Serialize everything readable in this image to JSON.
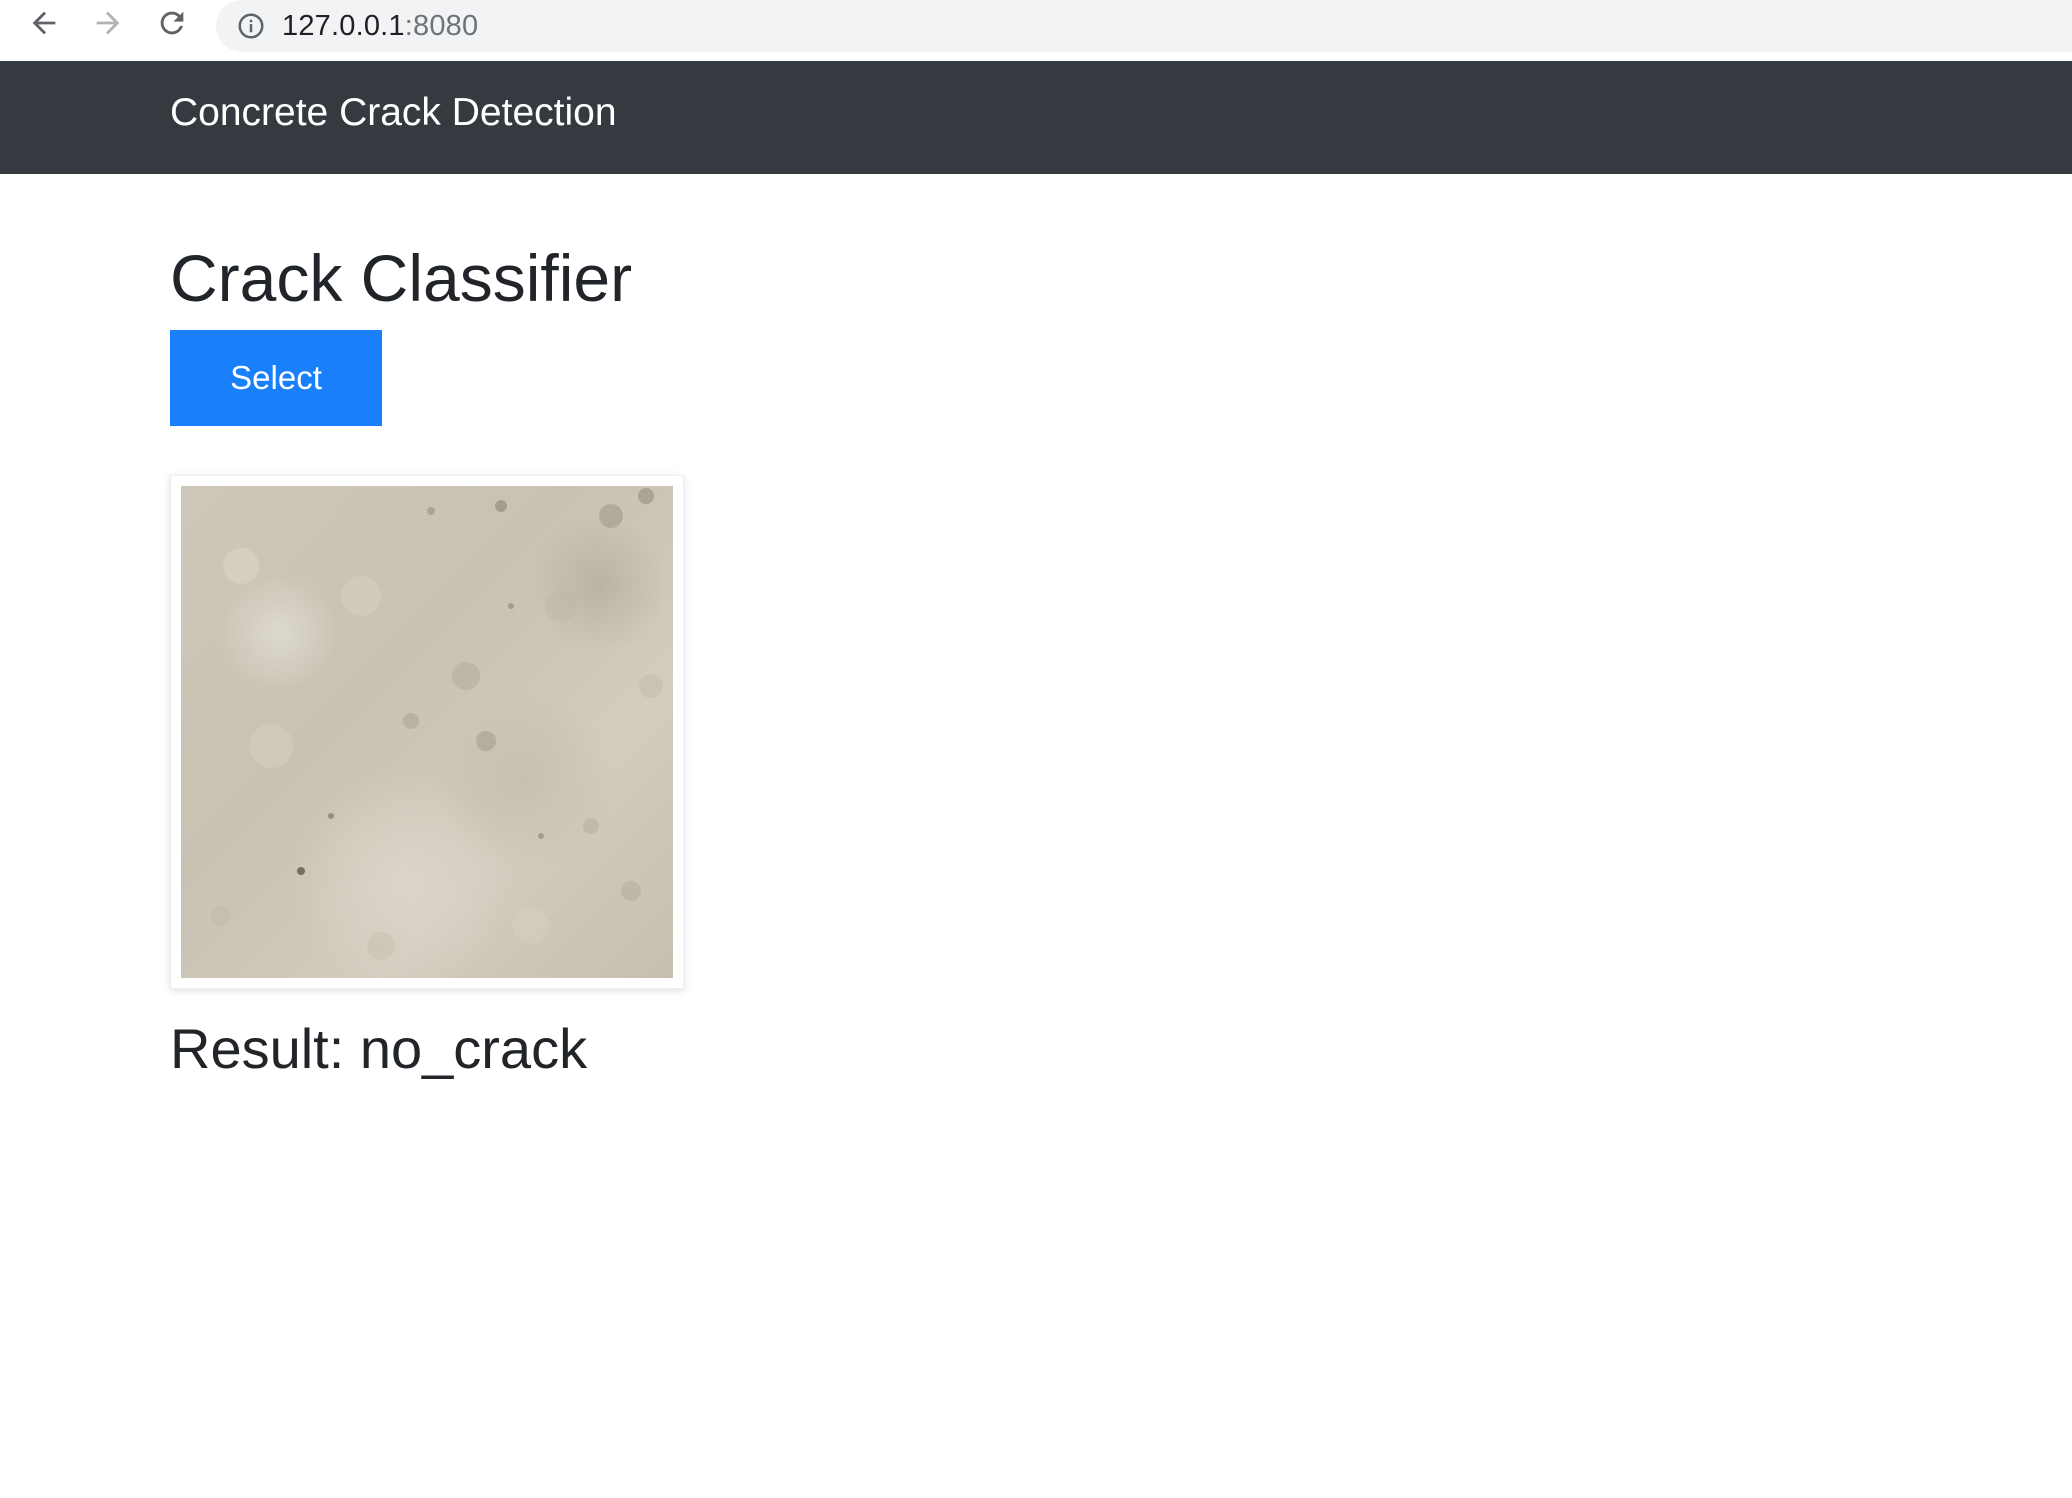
{
  "browser": {
    "url_host": "127.0.0.1",
    "url_port": ":8080",
    "icons": [
      "back-arrow-icon",
      "forward-arrow-icon",
      "reload-icon",
      "info-icon"
    ]
  },
  "navbar": {
    "brand": "Concrete Crack Detection",
    "background_color": "#343a40"
  },
  "main": {
    "title": "Crack Classifier",
    "select_button_label": "Select",
    "select_button_color": "#1a7ffa",
    "result_text": "Result: no_crack"
  }
}
